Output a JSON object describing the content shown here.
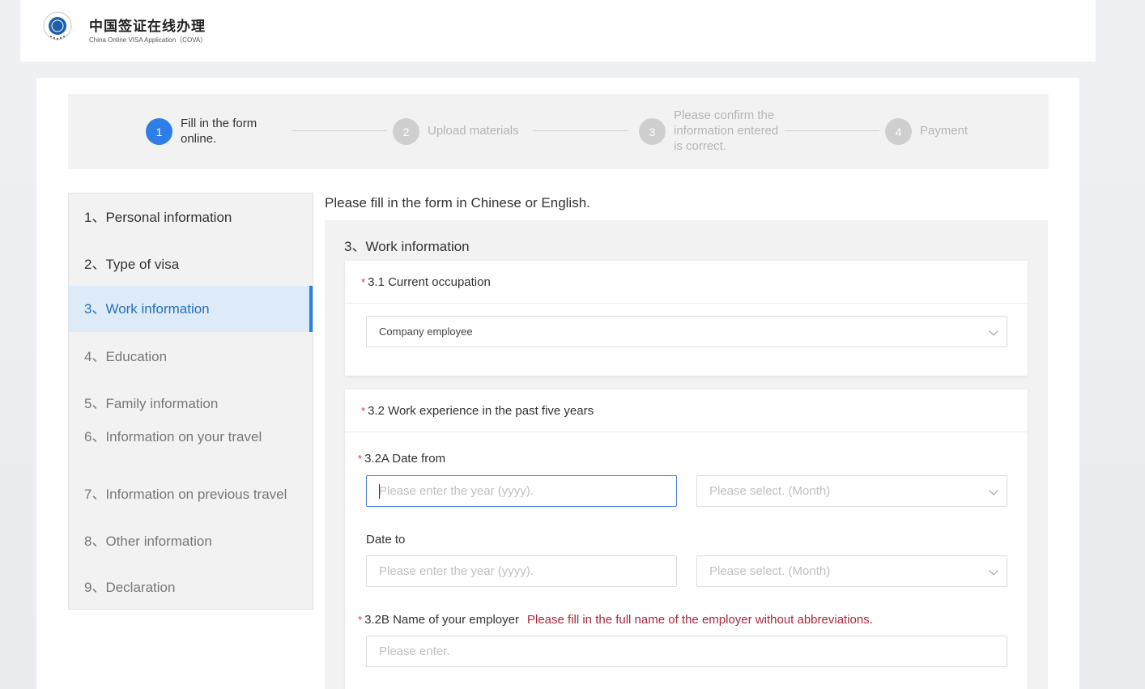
{
  "header": {
    "brand_cn": "中国签证在线办理",
    "brand_en": "China Online VISA Application（COVA）"
  },
  "steps": [
    {
      "num": "1",
      "label": "Fill in the form online.",
      "state": "active"
    },
    {
      "num": "2",
      "label": "Upload materials",
      "state": "inactive"
    },
    {
      "num": "3",
      "label": "Please confirm the information entered is correct.",
      "state": "inactive"
    },
    {
      "num": "4",
      "label": "Payment",
      "state": "inactive"
    }
  ],
  "sidebar": {
    "items": [
      {
        "label": "1、Personal information"
      },
      {
        "label": "2、Type of visa"
      },
      {
        "label": "3、Work information"
      },
      {
        "label": "4、Education"
      },
      {
        "label": "5、Family information"
      },
      {
        "label": "6、Information on your travel"
      },
      {
        "label": "7、Information on previous travel"
      },
      {
        "label": "8、Other information"
      },
      {
        "label": "9、Declaration"
      }
    ]
  },
  "main": {
    "instruction": "Please fill in the form in Chinese or English.",
    "section_title": "3、Work information",
    "occupation": {
      "label": "3.1 Current occupation",
      "value": "Company employee"
    },
    "experience": {
      "label": "3.2 Work experience in the past five years",
      "date_from_label": "3.2A Date from",
      "year_placeholder": "Please enter the year (yyyy).",
      "month_placeholder": "Please select. (Month)",
      "date_to_label": "Date to",
      "employer_label": "3.2B Name of your employer",
      "employer_note": "Please fill in the full name of the employer without abbreviations.",
      "employer_placeholder": "Please enter."
    }
  }
}
